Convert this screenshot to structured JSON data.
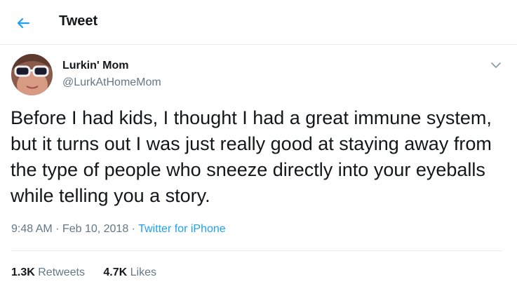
{
  "header": {
    "title": "Tweet",
    "back_icon": "arrow-left-icon",
    "accent_color": "#1da1f2"
  },
  "author": {
    "name": "Lurkin' Mom",
    "handle": "@LurkAtHomeMom",
    "avatar_icon": "avatar"
  },
  "tweet": {
    "text": "Before I had kids, I thought I had a great immune system, but it turns out I was just really good at staying away from the type of people who sneeze directly into your eyeballs while telling you a story.",
    "time": "9:48 AM",
    "separator": " · ",
    "date": "Feb 10, 2018",
    "source": "Twitter for iPhone"
  },
  "stats": {
    "retweets_count": "1.3K",
    "retweets_label": " Retweets",
    "likes_count": "4.7K",
    "likes_label": " Likes"
  },
  "colors": {
    "text": "#14171a",
    "secondary": "#657786",
    "link": "#1da1f2",
    "divider": "#e6ecf0"
  }
}
